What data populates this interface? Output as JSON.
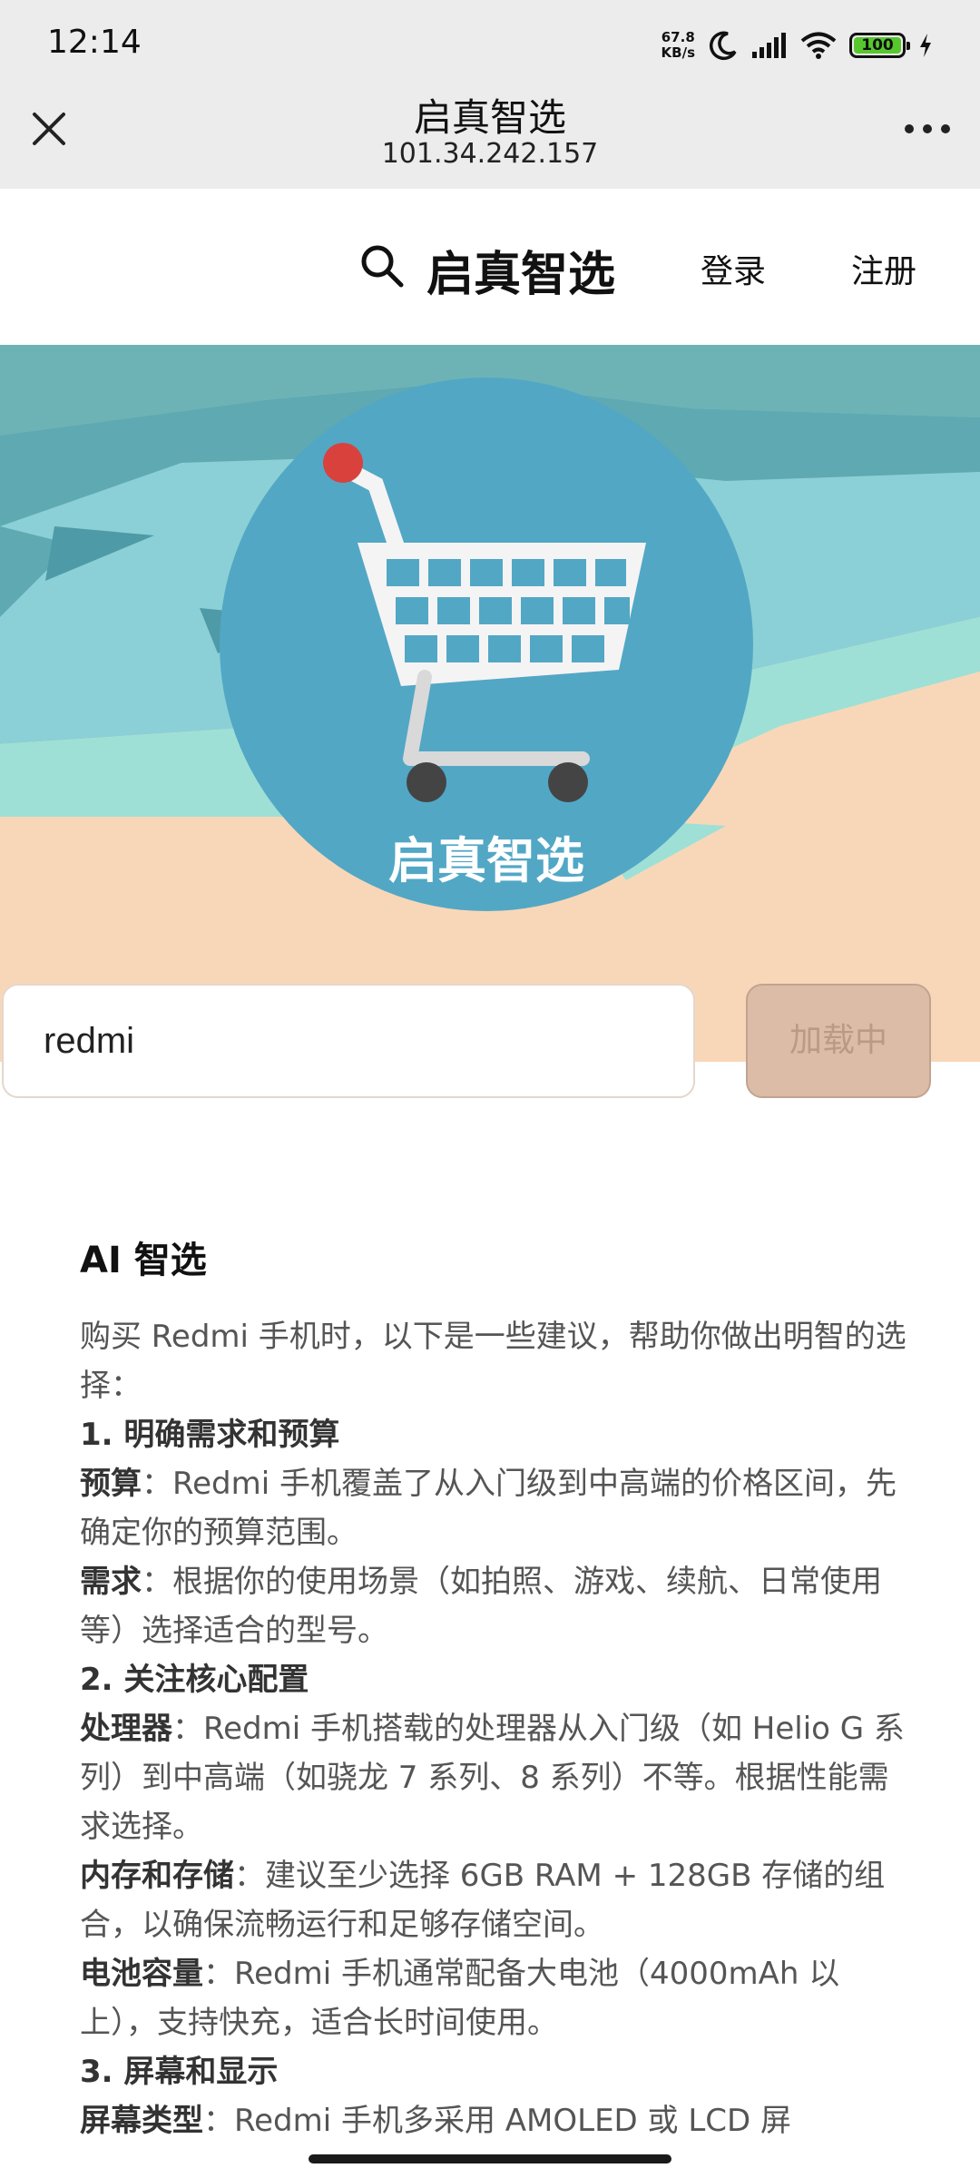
{
  "status_bar": {
    "time": "12:14",
    "net_speed_value": "67.8",
    "net_speed_unit": "KB/s",
    "battery": "100"
  },
  "browser": {
    "title": "启真智选",
    "url": "101.34.242.157"
  },
  "site_header": {
    "brand": "启真智选",
    "login": "登录",
    "register": "注册"
  },
  "hero": {
    "logo_text": "启真智选"
  },
  "search": {
    "value": "redmi",
    "button_label": "加载中"
  },
  "result": {
    "title": "AI 智选",
    "intro": "购买 Redmi 手机时，以下是一些建议，帮助你做出明智的选择：",
    "s1_title": "1. 明确需求和预算",
    "s1_i1_label": "预算",
    "s1_i1_text": "：Redmi 手机覆盖了从入门级到中高端的价格区间，先确定你的预算范围。",
    "s1_i2_label": "需求",
    "s1_i2_text": "：根据你的使用场景（如拍照、游戏、续航、日常使用等）选择适合的型号。",
    "s2_title": "2. 关注核心配置",
    "s2_i1_label": "处理器",
    "s2_i1_text": "：Redmi 手机搭载的处理器从入门级（如 Helio G 系列）到中高端（如骁龙 7 系列、8 系列）不等。根据性能需求选择。",
    "s2_i2_label": "内存和存储",
    "s2_i2_text": "：建议至少选择 6GB RAM + 128GB 存储的组合，以确保流畅运行和足够存储空间。",
    "s2_i3_label": "电池容量",
    "s2_i3_text": "：Redmi 手机通常配备大电池（4000mAh 以上），支持快充，适合长时间使用。",
    "s3_title": "3. 屏幕和显示",
    "s3_i1_label": "屏幕类型",
    "s3_i1_text": "：Redmi 手机多采用 AMOLED 或 LCD 屏"
  },
  "colors": {
    "hero_sand": "#f8d7b8",
    "logo_circle": "#52a7c5",
    "cart_dot": "#d9413d",
    "button_bg": "#dcbca7"
  }
}
